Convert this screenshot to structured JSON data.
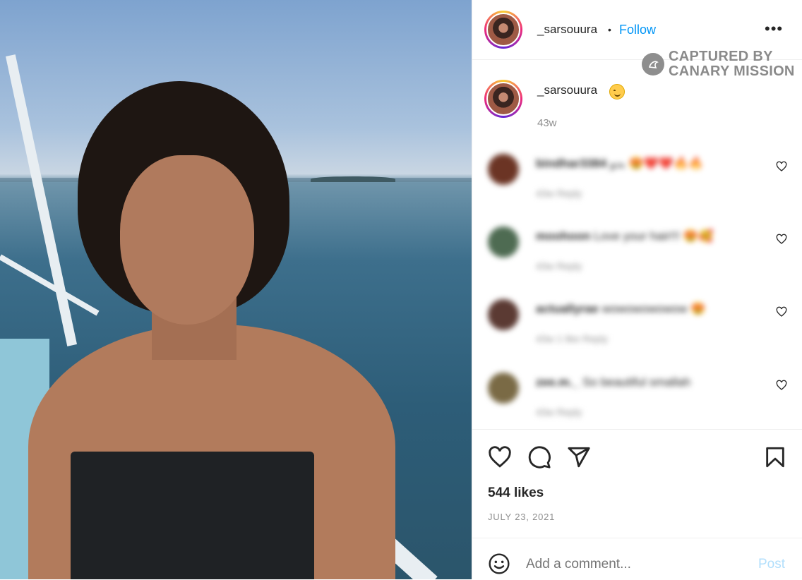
{
  "post": {
    "username": "_sarsouura",
    "separator": "•",
    "follow_label": "Follow",
    "more_label": "•••"
  },
  "watermark": {
    "line1": "CAPTURED BY",
    "line2": "CANARY MISSION",
    "icon": "canary-bird-icon"
  },
  "caption": {
    "username": "_sarsouura",
    "emoji": "smiling-face-icon",
    "time": "43w"
  },
  "comments": [
    {
      "user": "bindhar3384",
      "text": "بدو 😍❤️❤️🔥🔥",
      "meta": "43w  Reply",
      "avatar_color": "#6b3424"
    },
    {
      "user": "moohoon",
      "text": "Love your hair!!! 😍🥰",
      "meta": "43w  Reply",
      "avatar_color": "#4e6b52"
    },
    {
      "user": "actuallyrae",
      "text": "wowowowowow 😍",
      "meta": "43w  1 like  Reply",
      "avatar_color": "#5b3a33"
    },
    {
      "user": "zee.m._",
      "text": "So beautiful smallah",
      "meta": "43w  Reply",
      "avatar_color": "#7a6a45"
    }
  ],
  "actions": {
    "like_icon": "heart-icon",
    "comment_icon": "comment-icon",
    "share_icon": "share-icon",
    "save_icon": "bookmark-icon"
  },
  "likes": "544 likes",
  "date": "JULY 23, 2021",
  "add_comment": {
    "placeholder": "Add a comment...",
    "post_label": "Post",
    "emoji_icon": "emoji-icon"
  },
  "colors": {
    "link_blue": "#0095f6",
    "post_disabled": "#b2dffc",
    "muted": "#8e8e8e"
  }
}
